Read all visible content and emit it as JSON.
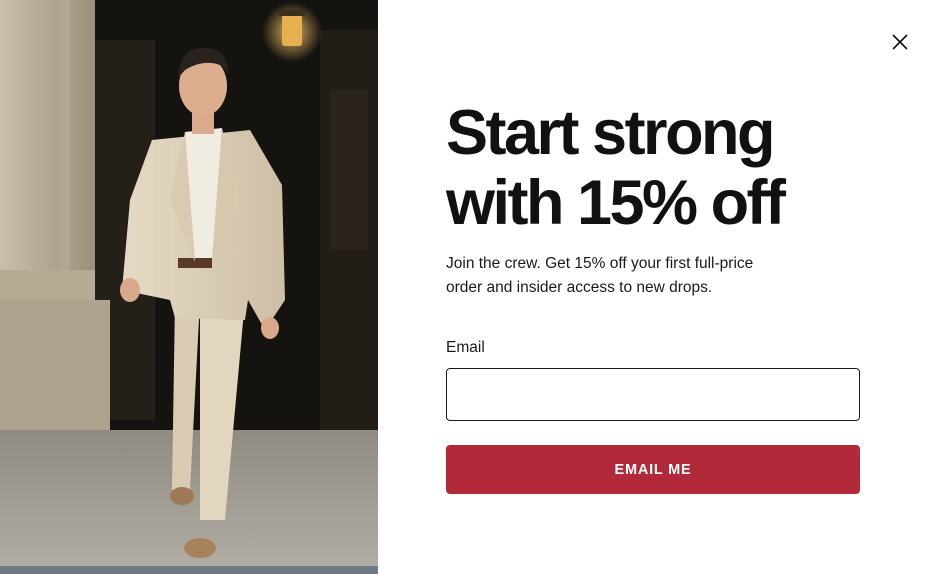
{
  "modal": {
    "headline_line1": "Start strong",
    "headline_line2": "with 15% off",
    "subtext_line1": "Join the crew. Get 15% off your first full-price",
    "subtext_line2": "order and insider access to new drops.",
    "email_label": "Email",
    "email_value": "",
    "email_placeholder": "",
    "submit_label": "EMAIL ME",
    "close_icon": "close-icon",
    "colors": {
      "accent": "#b2293a",
      "headline": "#111111",
      "background": "#ffffff"
    }
  },
  "photo": {
    "subject": "man-in-beige-suit"
  }
}
